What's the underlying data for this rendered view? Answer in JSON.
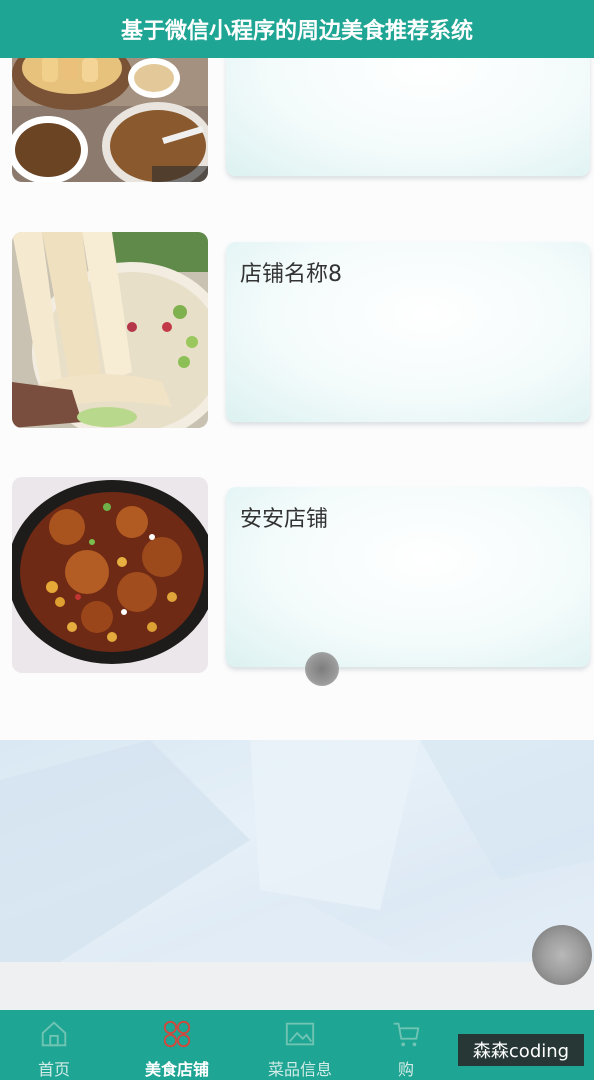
{
  "header": {
    "title": "基于微信小程序的周边美食推荐系统"
  },
  "shops": [
    {
      "name": "",
      "image": "fried-dough-sticks-and-soup-photo"
    },
    {
      "name": "店铺名称8",
      "image": "noodles-in-broth-photo"
    },
    {
      "name": "安安店铺",
      "image": "braised-pork-with-beans-photo"
    }
  ],
  "tabbar": {
    "items": [
      {
        "label": "首页",
        "icon": "home-icon"
      },
      {
        "label": "美食店铺",
        "icon": "four-leaf-shop-icon",
        "active": true
      },
      {
        "label": "菜品信息",
        "icon": "picture-icon"
      },
      {
        "label": "购",
        "icon": "cart-icon"
      }
    ]
  },
  "watermark": {
    "text": "森森coding"
  },
  "colors": {
    "primary": "#1fa593",
    "tab_inactive": "#d2ece7",
    "card_tint": "#dcf1f1"
  }
}
